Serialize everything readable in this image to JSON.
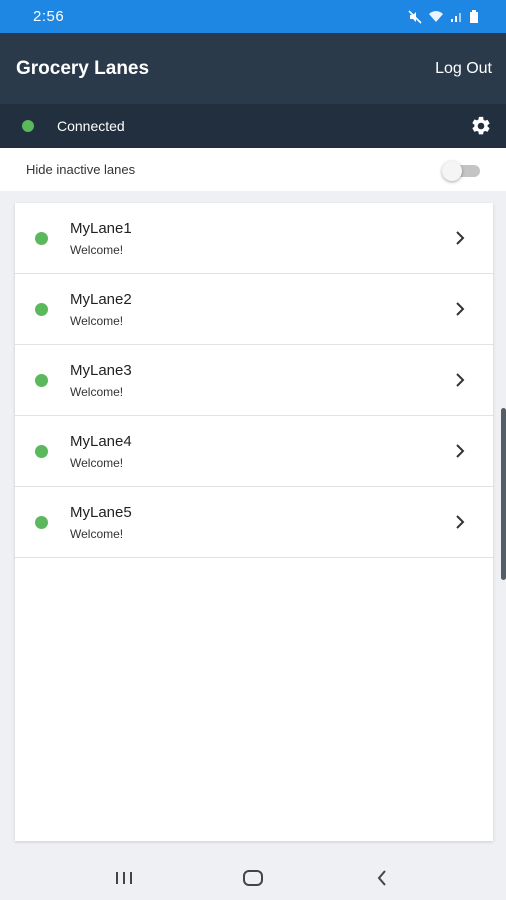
{
  "status_bar": {
    "time": "2:56",
    "icons": [
      "mute-icon",
      "wifi-icon",
      "signal-icon",
      "battery-icon"
    ]
  },
  "header": {
    "title": "Grocery Lanes",
    "logout_label": "Log Out"
  },
  "connection": {
    "status_label": "Connected",
    "status_color": "#5cb85c",
    "settings_icon": "gear-icon"
  },
  "filter": {
    "label": "Hide inactive lanes",
    "enabled": false
  },
  "lanes": [
    {
      "name": "MyLane1",
      "message": "Welcome!"
    },
    {
      "name": "MyLane2",
      "message": "Welcome!"
    },
    {
      "name": "MyLane3",
      "message": "Welcome!"
    },
    {
      "name": "MyLane4",
      "message": "Welcome!"
    },
    {
      "name": "MyLane5",
      "message": "Welcome!"
    }
  ],
  "nav": {
    "icons": [
      "recents-icon",
      "home-icon",
      "back-icon"
    ]
  },
  "colors": {
    "status_bar": "#1d87e3",
    "header": "#2b3a4a",
    "connection_bar": "#212f3e",
    "active_dot": "#5cb85c"
  }
}
